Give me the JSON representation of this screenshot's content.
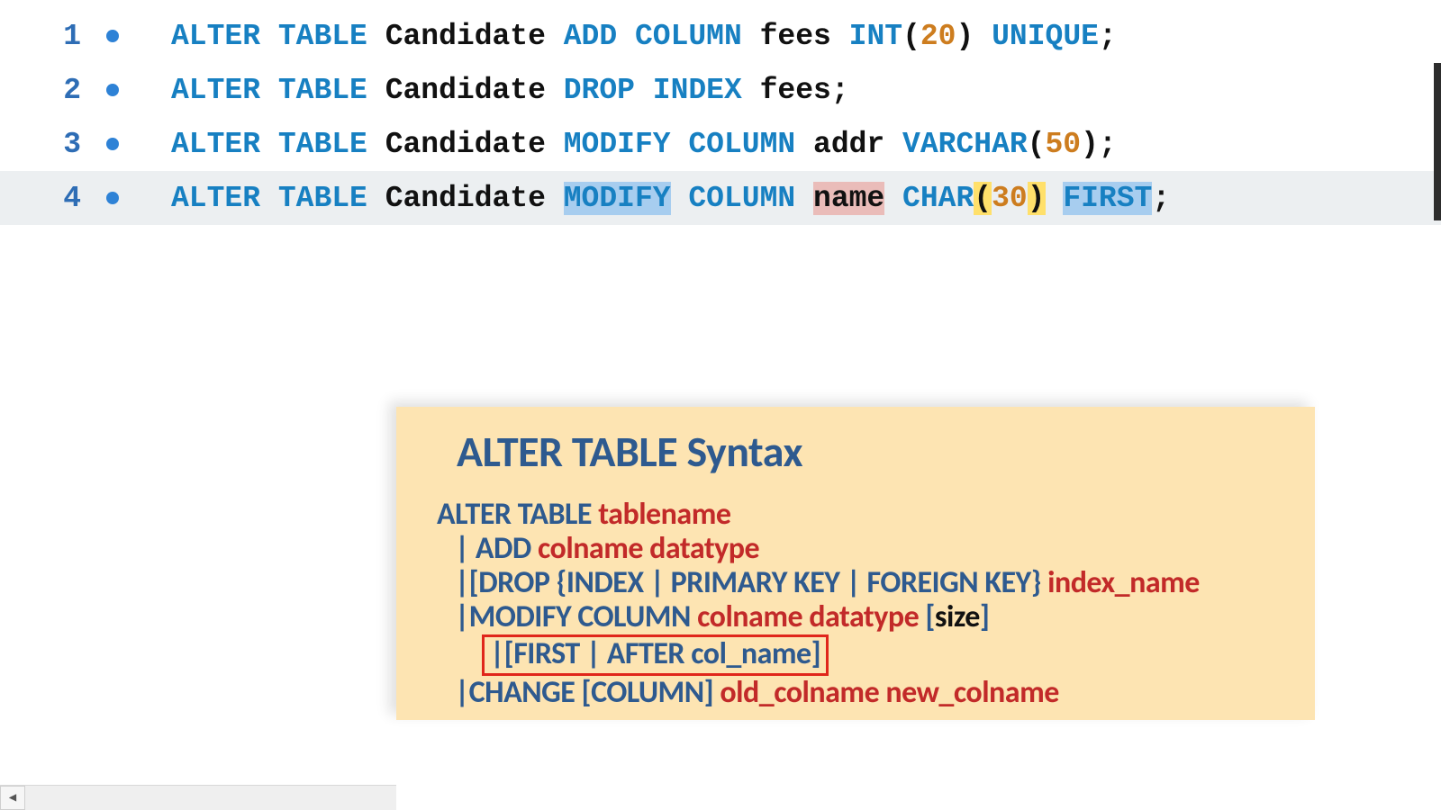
{
  "lines": [
    {
      "n": "1",
      "tokens": [
        {
          "t": "ALTER",
          "c": "kw"
        },
        {
          "t": " ",
          "c": ""
        },
        {
          "t": "TABLE",
          "c": "kw"
        },
        {
          "t": " ",
          "c": ""
        },
        {
          "t": "Candidate",
          "c": "id"
        },
        {
          "t": " ",
          "c": ""
        },
        {
          "t": "ADD",
          "c": "kw"
        },
        {
          "t": " ",
          "c": ""
        },
        {
          "t": "COLUMN",
          "c": "kw"
        },
        {
          "t": " ",
          "c": ""
        },
        {
          "t": "fees",
          "c": "id"
        },
        {
          "t": " ",
          "c": ""
        },
        {
          "t": "INT",
          "c": "kw"
        },
        {
          "t": "(",
          "c": "pn"
        },
        {
          "t": "20",
          "c": "num"
        },
        {
          "t": ")",
          "c": "pn"
        },
        {
          "t": " ",
          "c": ""
        },
        {
          "t": "UNIQUE",
          "c": "kw"
        },
        {
          "t": ";",
          "c": "pn"
        }
      ]
    },
    {
      "n": "2",
      "tokens": [
        {
          "t": "ALTER",
          "c": "kw"
        },
        {
          "t": " ",
          "c": ""
        },
        {
          "t": "TABLE",
          "c": "kw"
        },
        {
          "t": " ",
          "c": ""
        },
        {
          "t": "Candidate",
          "c": "id"
        },
        {
          "t": " ",
          "c": ""
        },
        {
          "t": "DROP",
          "c": "kw"
        },
        {
          "t": " ",
          "c": ""
        },
        {
          "t": "INDEX",
          "c": "kw"
        },
        {
          "t": " ",
          "c": ""
        },
        {
          "t": "fees",
          "c": "id"
        },
        {
          "t": ";",
          "c": "pn"
        }
      ]
    },
    {
      "n": "3",
      "tokens": [
        {
          "t": "ALTER",
          "c": "kw"
        },
        {
          "t": " ",
          "c": ""
        },
        {
          "t": "TABLE",
          "c": "kw"
        },
        {
          "t": " ",
          "c": ""
        },
        {
          "t": "Candidate",
          "c": "id"
        },
        {
          "t": " ",
          "c": ""
        },
        {
          "t": "MODIFY",
          "c": "kw"
        },
        {
          "t": " ",
          "c": ""
        },
        {
          "t": "COLUMN",
          "c": "kw"
        },
        {
          "t": " ",
          "c": ""
        },
        {
          "t": "addr",
          "c": "id"
        },
        {
          "t": " ",
          "c": ""
        },
        {
          "t": "VARCHAR",
          "c": "kw"
        },
        {
          "t": "(",
          "c": "pn"
        },
        {
          "t": "50",
          "c": "num"
        },
        {
          "t": ")",
          "c": "pn"
        },
        {
          "t": ";",
          "c": "pn"
        }
      ]
    },
    {
      "n": "4",
      "current": true,
      "tokens": [
        {
          "t": "ALTER",
          "c": "kw"
        },
        {
          "t": " ",
          "c": ""
        },
        {
          "t": "TABLE",
          "c": "kw"
        },
        {
          "t": " ",
          "c": ""
        },
        {
          "t": "Candidate",
          "c": "id"
        },
        {
          "t": " ",
          "c": ""
        },
        {
          "t": "MODIFY",
          "c": "kw",
          "hl": "hl-blue"
        },
        {
          "t": " ",
          "c": ""
        },
        {
          "t": "COLUMN",
          "c": "kw"
        },
        {
          "t": " ",
          "c": ""
        },
        {
          "t": "name",
          "c": "id",
          "hl": "hl-pink"
        },
        {
          "t": " ",
          "c": ""
        },
        {
          "t": "CHAR",
          "c": "kw"
        },
        {
          "t": "(",
          "c": "pn",
          "hl": "hl-yell"
        },
        {
          "t": "30",
          "c": "num"
        },
        {
          "t": ")",
          "c": "pn",
          "hl": "hl-yell"
        },
        {
          "t": " ",
          "c": ""
        },
        {
          "t": "FIRST",
          "c": "kw",
          "hl": "hl-blue"
        },
        {
          "t": ";",
          "c": "pn"
        }
      ]
    }
  ],
  "tooltip": {
    "title": "ALTER TABLE Syntax",
    "line1": [
      {
        "t": "ALTER  TABLE ",
        "c": "b"
      },
      {
        "t": "tablename",
        "c": "r"
      }
    ],
    "line2": [
      {
        "t": "| ",
        "c": "b"
      },
      {
        "t": "ADD ",
        "c": "b"
      },
      {
        "t": "colname datatype",
        "c": "r"
      }
    ],
    "line3": [
      {
        "t": "|[DROP {INDEX | PRIMARY KEY | FOREIGN KEY} ",
        "c": "b"
      },
      {
        "t": "index_name",
        "c": "r"
      }
    ],
    "line4": [
      {
        "t": "|MODIFY COLUMN ",
        "c": "b"
      },
      {
        "t": "colname  datatype ",
        "c": "r"
      },
      {
        "t": "[",
        "c": "b"
      },
      {
        "t": "size",
        "c": "k"
      },
      {
        "t": "]",
        "c": "b"
      }
    ],
    "line5_boxed": [
      {
        "t": "|[FIRST | AFTER col_name]",
        "c": "b"
      }
    ],
    "line6": [
      {
        "t": "|CHANGE [COLUMN] ",
        "c": "b"
      },
      {
        "t": "old_colname new_colname",
        "c": "r"
      }
    ]
  },
  "scroll_left_glyph": "◀"
}
